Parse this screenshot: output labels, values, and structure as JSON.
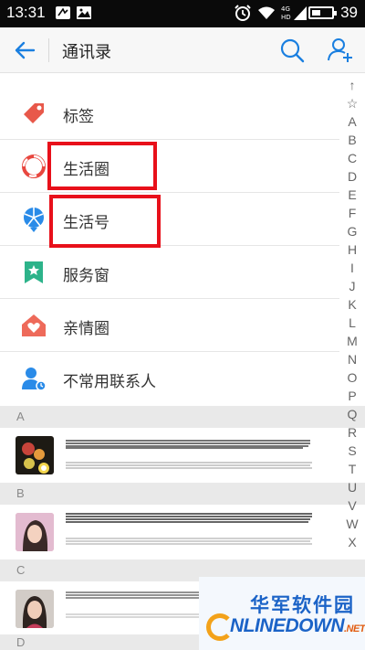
{
  "status_bar": {
    "time": "13:31",
    "battery_level": "39",
    "icons": [
      "notification-icon",
      "image-icon",
      "alarm-icon",
      "wifi-icon",
      "signal-icon",
      "battery-icon"
    ]
  },
  "app_bar": {
    "title": "通讯录",
    "icons": [
      "back-arrow-icon",
      "search-icon",
      "add-contact-icon"
    ]
  },
  "menu": {
    "items": [
      {
        "label": "标签",
        "icon": "tag-icon",
        "color": "#e8584a"
      },
      {
        "label": "生活圈",
        "icon": "life-circle-icon",
        "color": "#e8473f"
      },
      {
        "label": "生活号",
        "icon": "life-account-icon",
        "color": "#2a8be8"
      },
      {
        "label": "服务窗",
        "icon": "service-window-icon",
        "color": "#2db38a"
      },
      {
        "label": "亲情圈",
        "icon": "family-circle-icon",
        "color": "#ee6a5a"
      },
      {
        "label": "不常用联系人",
        "icon": "infrequent-contact-icon",
        "color": "#2a8be8"
      }
    ]
  },
  "index_letters": [
    "↑",
    "☆",
    "A",
    "B",
    "C",
    "D",
    "E",
    "F",
    "G",
    "H",
    "I",
    "J",
    "K",
    "L",
    "M",
    "N",
    "O",
    "P",
    "Q",
    "R",
    "S",
    "T",
    "U",
    "V",
    "W",
    "X"
  ],
  "sections": [
    {
      "letter": "A"
    },
    {
      "letter": "B"
    },
    {
      "letter": "C"
    },
    {
      "letter": "D"
    }
  ],
  "watermark": {
    "chinese": "华军软件园",
    "english": "NLINEDOWN",
    "suffix": ".NET"
  },
  "colors": {
    "accent": "#1a7fe0",
    "highlight": "#e8101a",
    "section_bg": "#e9e9e9"
  }
}
